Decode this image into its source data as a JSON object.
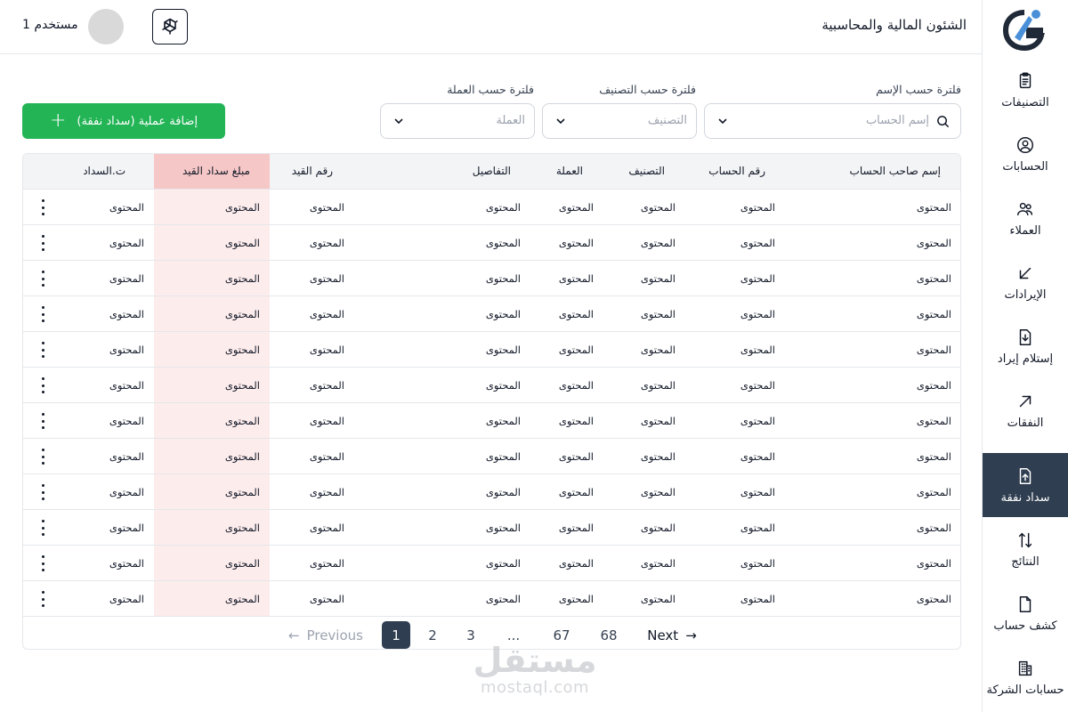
{
  "header": {
    "title": "الشئون المالية والمحاسبية",
    "username": "مستخدم 1"
  },
  "sidebar": {
    "items": [
      {
        "label": "التصنيفات",
        "icon": "clipboard-icon"
      },
      {
        "label": "الحسابات",
        "icon": "user-circle-icon"
      },
      {
        "label": "العملاء",
        "icon": "users-icon"
      },
      {
        "label": "الإيرادات",
        "icon": "arrow-down-left-icon"
      },
      {
        "label": "إستلام إيراد",
        "icon": "file-download-icon"
      },
      {
        "label": "النفقات",
        "icon": "arrow-up-right-icon"
      },
      {
        "label": "سداد نفقة",
        "icon": "file-upload-icon",
        "active": true
      },
      {
        "label": "النتائج",
        "icon": "arrows-up-down-icon"
      },
      {
        "label": "كشف حساب",
        "icon": "file-icon"
      },
      {
        "label": "حسابات الشركة",
        "icon": "building-icon"
      }
    ]
  },
  "filters": {
    "name": {
      "label": "فلترة حسب الإسم",
      "placeholder": "إسم الحساب"
    },
    "category": {
      "label": "فلترة حسب التصنيف",
      "placeholder": "التصنيف"
    },
    "currency": {
      "label": "فلترة حسب العملة",
      "placeholder": "العملة"
    }
  },
  "add_button": {
    "label": "إضافة عملية (سداد نفقة)"
  },
  "table": {
    "headers": {
      "account_holder": "إسم صاحب الحساب",
      "account_number": "رقم الحساب",
      "category": "التصنيف",
      "currency": "العملة",
      "details": "التفاصيل",
      "entry_number": "رقم القيد",
      "entry_amount": "مبلغ سداد القيد",
      "payment_date": "ت.السداد"
    },
    "cell_text": "المحتوى",
    "row_count": 12
  },
  "pagination": {
    "previous": "Previous",
    "next": "Next",
    "pages": [
      "1",
      "2",
      "3",
      "...",
      "67",
      "68"
    ],
    "current": "1"
  },
  "watermark": {
    "arabic": "مستقل",
    "latin": "mostaql.com"
  },
  "colors": {
    "accent_dark": "#2f3e50",
    "green": "#22b455",
    "highlight_head": "#f6c7c7",
    "highlight_col": "#fdecec"
  }
}
